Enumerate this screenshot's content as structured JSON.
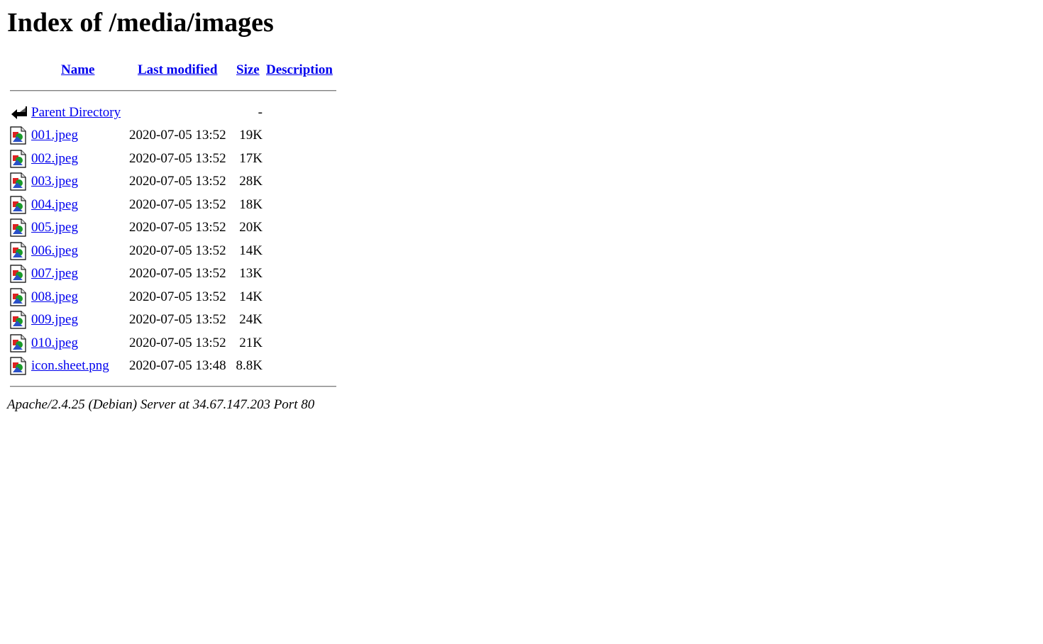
{
  "page": {
    "title": "Index of /media/images"
  },
  "columns": {
    "name": "Name",
    "last_modified": "Last modified",
    "size": "Size",
    "description": "Description"
  },
  "parent": {
    "label": "Parent Directory",
    "size": "-",
    "icon": "back-arrow-icon"
  },
  "files": [
    {
      "name": "001.jpeg",
      "modified": "2020-07-05 13:52",
      "size": "19K",
      "icon": "image-file-icon"
    },
    {
      "name": "002.jpeg",
      "modified": "2020-07-05 13:52",
      "size": "17K",
      "icon": "image-file-icon"
    },
    {
      "name": "003.jpeg",
      "modified": "2020-07-05 13:52",
      "size": "28K",
      "icon": "image-file-icon"
    },
    {
      "name": "004.jpeg",
      "modified": "2020-07-05 13:52",
      "size": "18K",
      "icon": "image-file-icon"
    },
    {
      "name": "005.jpeg",
      "modified": "2020-07-05 13:52",
      "size": "20K",
      "icon": "image-file-icon"
    },
    {
      "name": "006.jpeg",
      "modified": "2020-07-05 13:52",
      "size": "14K",
      "icon": "image-file-icon"
    },
    {
      "name": "007.jpeg",
      "modified": "2020-07-05 13:52",
      "size": "13K",
      "icon": "image-file-icon"
    },
    {
      "name": "008.jpeg",
      "modified": "2020-07-05 13:52",
      "size": "14K",
      "icon": "image-file-icon"
    },
    {
      "name": "009.jpeg",
      "modified": "2020-07-05 13:52",
      "size": "24K",
      "icon": "image-file-icon"
    },
    {
      "name": "010.jpeg",
      "modified": "2020-07-05 13:52",
      "size": "21K",
      "icon": "image-file-icon"
    },
    {
      "name": "icon.sheet.png",
      "modified": "2020-07-05 13:48",
      "size": "8.8K",
      "icon": "image-file-icon"
    }
  ],
  "footer": {
    "signature": "Apache/2.4.25 (Debian) Server at 34.67.147.203 Port 80"
  },
  "colors": {
    "link": "#0000ee",
    "text": "#000000",
    "background": "#ffffff"
  }
}
